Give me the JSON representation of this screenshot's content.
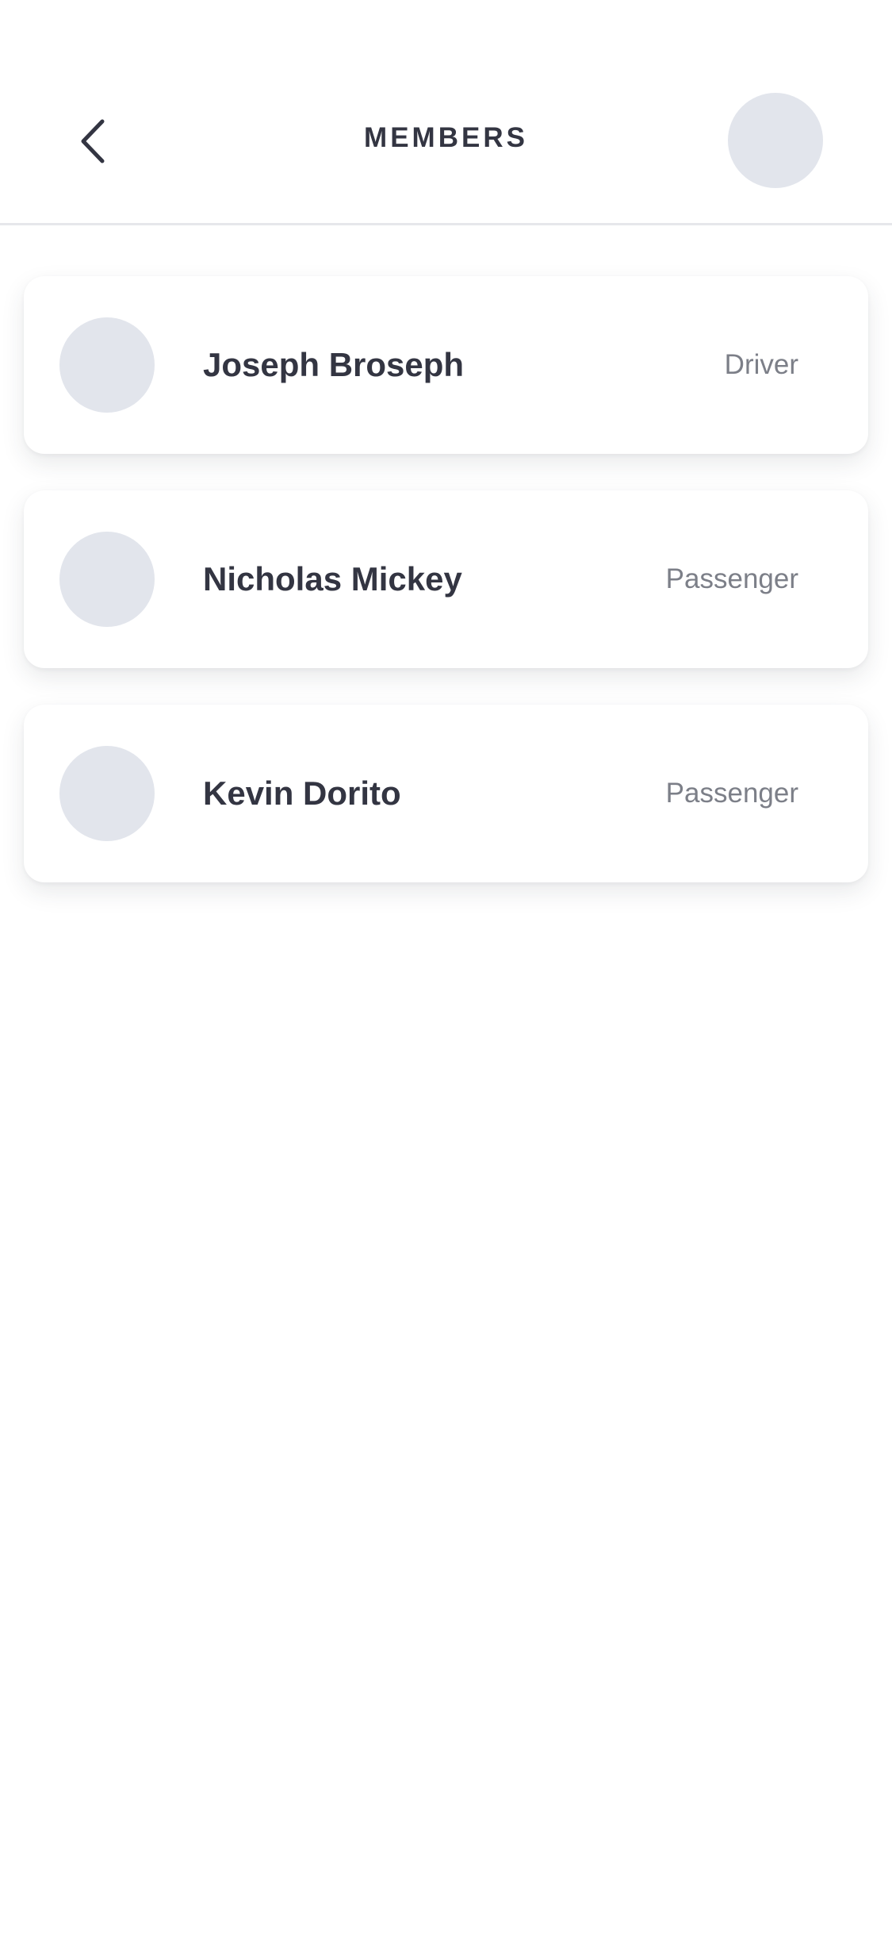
{
  "header": {
    "title": "MEMBERS",
    "back_icon": "chevron-left-icon"
  },
  "members": [
    {
      "name": "Joseph Broseph",
      "role": "Driver"
    },
    {
      "name": "Nicholas Mickey",
      "role": "Passenger"
    },
    {
      "name": "Kevin Dorito",
      "role": "Passenger"
    }
  ],
  "colors": {
    "text_primary": "#333542",
    "text_secondary": "#7c7f88",
    "avatar_placeholder": "#e2e5ec",
    "divider": "#e6e7eb"
  }
}
